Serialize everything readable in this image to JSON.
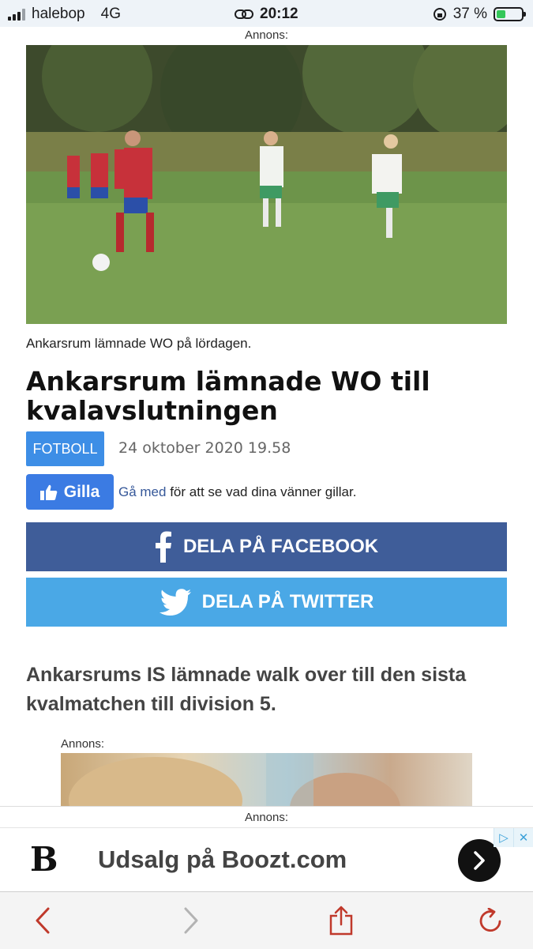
{
  "status_bar": {
    "carrier": "halebop",
    "network": "4G",
    "time": "20:12",
    "battery_percent": "37 %",
    "battery_level": 0.37,
    "accent_battery": "#34c759"
  },
  "ads": {
    "top_label": "Annons:",
    "inline_label": "Annons:",
    "sticky_label": "Annons:",
    "banner": {
      "logo": "B",
      "text": "Udsalg på Boozt.com",
      "go_icon": "chevron-right-icon"
    }
  },
  "article": {
    "hero_icon": "football-photo",
    "caption": "Ankarsrum lämnade WO på lördagen.",
    "headline": "Ankarsrum lämnade WO till kvalavslutningen",
    "category": "FOTBOLL",
    "date": "24 oktober 2020 19.58",
    "lead": "Ankarsrums IS lämnade walk over till den sista kvalmatchen till division 5."
  },
  "social": {
    "like_label": "Gilla",
    "like_prompt_link": "Gå med",
    "like_prompt_text": " för att se vad dina vänner gillar.",
    "facebook_label": "DELA PÅ FACEBOOK",
    "twitter_label": "DELA PÅ TWITTER",
    "colors": {
      "facebook": "#3f5d99",
      "twitter": "#4aa8e6",
      "like": "#3b7be3"
    }
  },
  "toolbar": {
    "back_icon": "chevron-left-icon",
    "forward_icon": "chevron-right-icon",
    "share_icon": "share-icon",
    "reload_icon": "reload-icon",
    "accent": "#c0392b"
  }
}
